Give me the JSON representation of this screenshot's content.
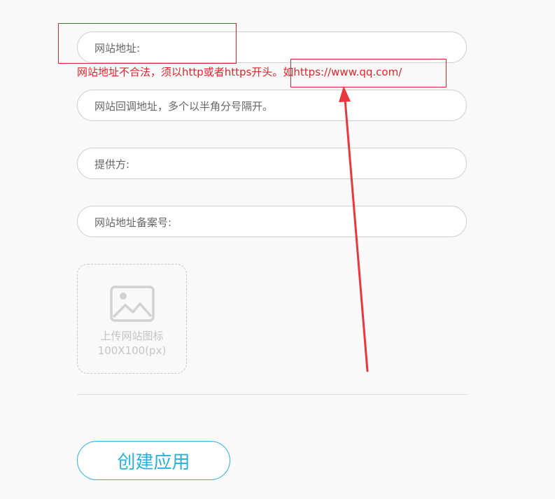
{
  "form": {
    "url_field": {
      "placeholder": "网站地址:",
      "value": ""
    },
    "url_error": "网站地址不合法，须以http或者https开头。如https://www.qq.com/",
    "callback_field": {
      "placeholder": "网站回调地址，多个以半角分号隔开。",
      "value": ""
    },
    "provider_field": {
      "placeholder": "提供方:",
      "value": ""
    },
    "icp_field": {
      "placeholder": "网站地址备案号:",
      "value": ""
    },
    "upload": {
      "label": "上传网站图标",
      "size": "100X100(px)",
      "icon": "image-icon"
    },
    "submit_label": "创建应用"
  },
  "colors": {
    "error": "#e0242b",
    "accent": "#2ab0dd",
    "annotation": "#e8383d"
  }
}
